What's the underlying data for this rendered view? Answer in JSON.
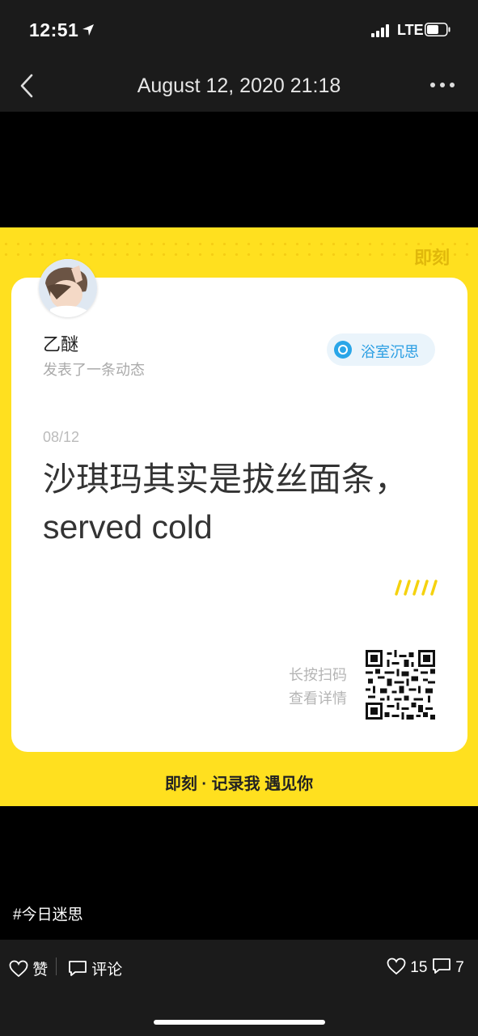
{
  "status_bar": {
    "time": "12:51",
    "network": "LTE"
  },
  "nav": {
    "title": "August 12, 2020 21:18",
    "back_icon": "chevron-left-icon",
    "more_icon": "more-dots-icon"
  },
  "share_card": {
    "brand_top": "即刻",
    "username": "乙醚",
    "action": "发表了一条动态",
    "topic": "浴室沉思",
    "date": "08/12",
    "content": "沙琪玛其实是拔丝面条，served cold",
    "qr_hint_line1": "长按扫码",
    "qr_hint_line2": "查看详情",
    "footer_brand": "即刻 · 记录我 遇见你",
    "colors": {
      "background": "#ffe01f",
      "topic_accent": "#2aa6e8"
    }
  },
  "hashtag": "#今日迷思",
  "actions": {
    "like_label": "赞",
    "comment_label": "评论",
    "like_count": "15",
    "comment_count": "7"
  }
}
